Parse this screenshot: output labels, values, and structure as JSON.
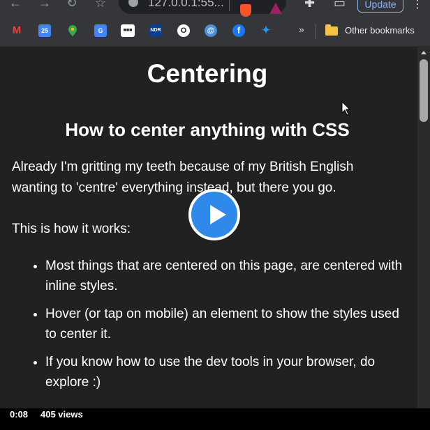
{
  "browser": {
    "nav": {
      "back_icon": "arrow-left-icon",
      "forward_icon": "arrow-right-icon",
      "reload_icon": "reload-icon",
      "bookmark_icon": "star-icon"
    },
    "url": "127.0.0.1:55...",
    "extensions": {
      "puzzle_icon": "puzzle-icon",
      "profile_icon": "window-icon"
    },
    "update_label": "Update"
  },
  "bookmarks": {
    "items": [
      {
        "name": "gmail",
        "glyph": "M",
        "color": "#ea4335"
      },
      {
        "name": "calendar",
        "glyph": "25",
        "color": "#4285f4"
      },
      {
        "name": "maps",
        "glyph": "",
        "color": "#34a853"
      },
      {
        "name": "translate",
        "glyph": "G",
        "color": "#4285f4"
      },
      {
        "name": "site-tiles",
        "glyph": "■■■",
        "color": "#ffffff"
      },
      {
        "name": "ndr",
        "glyph": "NDR",
        "color": "#0b3d91"
      },
      {
        "name": "site-o",
        "glyph": "O",
        "color": "#ffffff"
      },
      {
        "name": "site-globe",
        "glyph": "@",
        "color": "#4a90d9"
      },
      {
        "name": "facebook",
        "glyph": "f",
        "color": "#1877f2"
      },
      {
        "name": "twitter",
        "glyph": "✦",
        "color": "#1d9bf0"
      }
    ],
    "more": "»",
    "other_bookmarks": "Other bookmarks"
  },
  "page": {
    "title": "Centering",
    "subtitle": "How to center anything with CSS",
    "intro_line1": "Already I'm gritting my teeth because of my British English",
    "intro_line2": "wanting to 'centre' everything instead, but there you go.",
    "how_it_works": "This is how it works:",
    "bullets": [
      "Most things that are centered on this page, are centered with inline styles.",
      "Hover (or tap on mobile) an element to show the styles used to center it.",
      "If you know how to use the dev tools in your browser, do explore :)"
    ]
  },
  "video": {
    "time": "0:08",
    "views": "405 views"
  }
}
